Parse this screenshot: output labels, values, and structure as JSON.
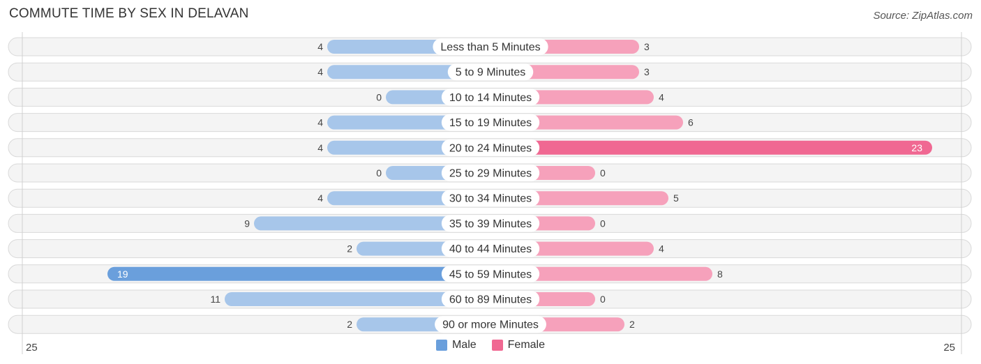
{
  "header": {
    "title": "COMMUTE TIME BY SEX IN DELAVAN",
    "source": "Source: ZipAtlas.com"
  },
  "legend": {
    "items": [
      {
        "label": "Male",
        "color": "#6a9fdc"
      },
      {
        "label": "Female",
        "color": "#f06892"
      }
    ]
  },
  "chart_data": {
    "type": "bar",
    "orientation": "horizontal-diverging",
    "title": "COMMUTE TIME BY SEX IN DELAVAN",
    "categories": [
      "Less than 5 Minutes",
      "5 to 9 Minutes",
      "10 to 14 Minutes",
      "15 to 19 Minutes",
      "20 to 24 Minutes",
      "25 to 29 Minutes",
      "30 to 34 Minutes",
      "35 to 39 Minutes",
      "40 to 44 Minutes",
      "45 to 59 Minutes",
      "60 to 89 Minutes",
      "90 or more Minutes"
    ],
    "series": [
      {
        "name": "Male",
        "side": "left",
        "color": "#a7c6ea",
        "highlight_color": "#6a9fdc",
        "values": [
          4,
          4,
          0,
          4,
          4,
          0,
          4,
          9,
          2,
          19,
          11,
          2
        ]
      },
      {
        "name": "Female",
        "side": "right",
        "color": "#f6a1bb",
        "highlight_color": "#f06892",
        "values": [
          3,
          3,
          4,
          6,
          23,
          0,
          5,
          0,
          4,
          8,
          0,
          2
        ]
      }
    ],
    "axis": {
      "min_label": "25",
      "max_label": "25",
      "range": [
        -25,
        25
      ]
    },
    "legend_position": "bottom-center",
    "grid": false
  }
}
